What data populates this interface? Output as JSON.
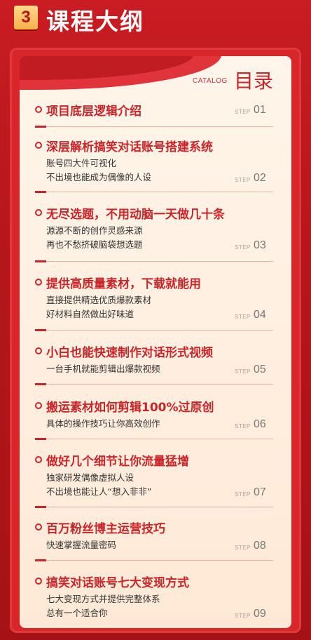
{
  "header": {
    "number": "3",
    "title": "课程大纲"
  },
  "catalog": {
    "en": "CATALOG",
    "cn": "目录"
  },
  "step_label": "STEP",
  "items": [
    {
      "title": "项目底层逻辑介绍",
      "desc": [],
      "step": "01"
    },
    {
      "title": "深层解析搞笑对话账号搭建系统",
      "desc": [
        "账号四大件可视化",
        "不出境也能成为偶像的人设"
      ],
      "step": "02"
    },
    {
      "title": "无尽选题，不用动脑一天做几十条",
      "desc": [
        "源源不断的创作灵感来源",
        "再也不愁挤破脑袋想选题"
      ],
      "step": "03"
    },
    {
      "title": "提供高质量素材，下载就能用",
      "desc": [
        "直接提供精选优质爆款素材",
        "好材料自然做出好味道"
      ],
      "step": "04"
    },
    {
      "title": "小白也能快速制作对话形式视频",
      "desc": [
        "一台手机就能剪辑出爆款视频"
      ],
      "step": "05"
    },
    {
      "title": "搬运素材如何剪辑100%过原创",
      "desc": [
        "具体的操作技巧让你高效创作"
      ],
      "step": "06"
    },
    {
      "title": "做好几个细节让你流量猛增",
      "desc": [
        "独家研发偶像虚拟人设",
        "不出境也能让人“想入非非”"
      ],
      "step": "07"
    },
    {
      "title": "百万粉丝博主运营技巧",
      "desc": [
        "快速掌握流量密码"
      ],
      "step": "08"
    },
    {
      "title": "搞笑对话账号七大变现方式",
      "desc": [
        "七大变现方式并提供完整体系",
        "总有一个适合你"
      ],
      "step": "09"
    }
  ]
}
